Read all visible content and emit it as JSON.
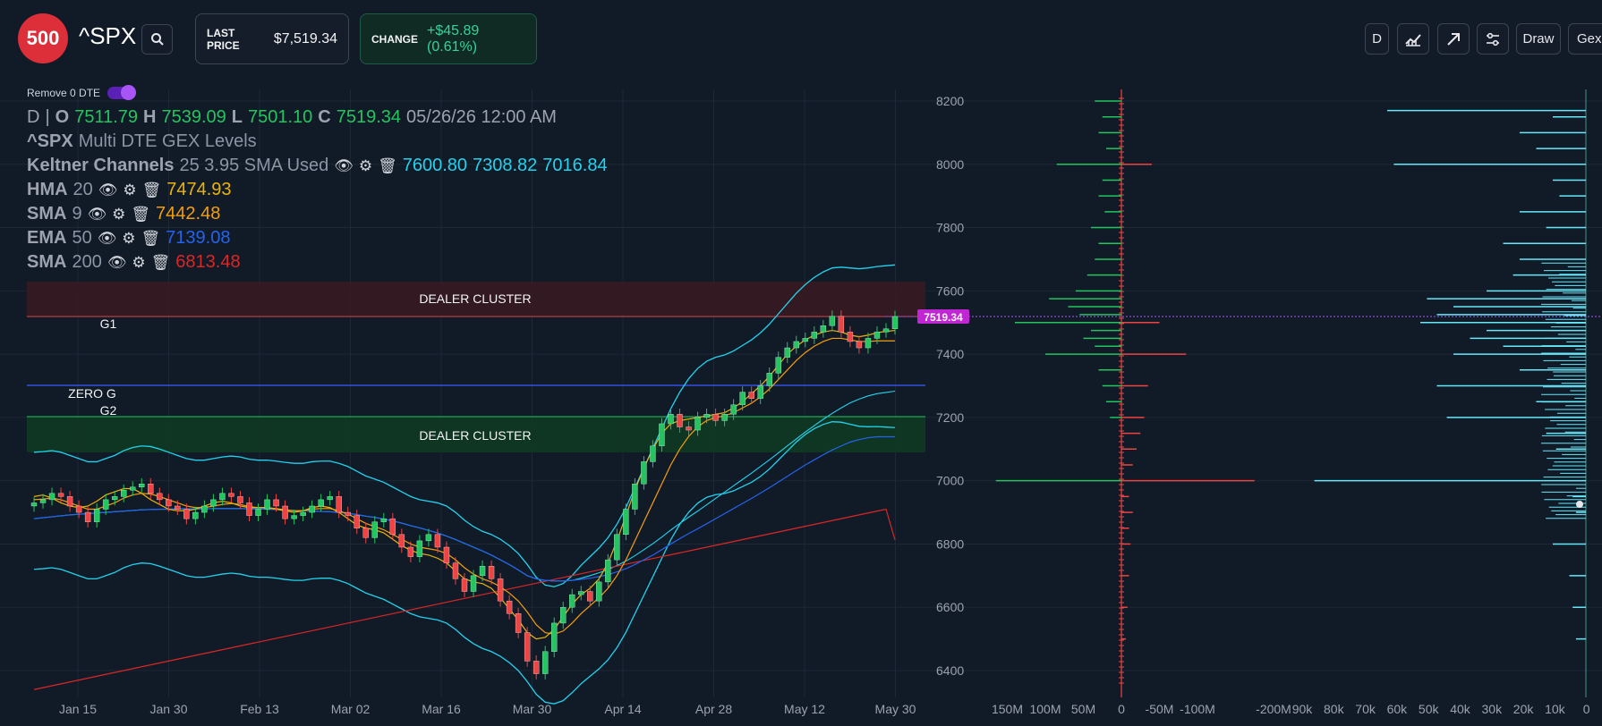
{
  "header": {
    "logo": "500",
    "ticker": "^SPX",
    "last_price_label": "LAST PRICE",
    "last_price": "$7,519.34",
    "change_label": "CHANGE",
    "change": "+$45.89 (0.61%)",
    "buttons": {
      "interval": "D",
      "draw": "Draw",
      "gex": "Gex"
    }
  },
  "toggle": {
    "label": "Remove 0 DTE",
    "on": true
  },
  "ohlc": {
    "interval": "D",
    "o_label": "O",
    "o": "7511.79",
    "h_label": "H",
    "h": "7539.09",
    "l_label": "L",
    "l": "7501.10",
    "c_label": "C",
    "c": "7519.34",
    "datetime": "05/26/26 12:00 AM"
  },
  "indicators": {
    "title_sym": "^SPX",
    "title_rest": "Multi DTE GEX Levels",
    "keltner_name": "Keltner Channels",
    "keltner_params": "25 3.95 SMA Used",
    "keltner_upper": "7600.80",
    "keltner_mid": "7308.82",
    "keltner_lower": "7016.84",
    "hma_name": "HMA",
    "hma_param": "20",
    "hma_val": "7474.93",
    "sma9_name": "SMA",
    "sma9_param": "9",
    "sma9_val": "7442.48",
    "ema_name": "EMA",
    "ema_param": "50",
    "ema_val": "7139.08",
    "sma200_name": "SMA",
    "sma200_param": "200",
    "sma200_val": "6813.48"
  },
  "levels": {
    "dealer_cluster_top": "DEALER CLUSTER",
    "dealer_cluster_bottom": "DEALER CLUSTER",
    "g1": "G1",
    "zero_g": "ZERO G",
    "g2": "G2",
    "price_tag": "7519.34"
  },
  "colors": {
    "up": "#22c55e",
    "down": "#ef4444",
    "keltner": "#22d3ee",
    "hma": "#eab308",
    "sma9": "#f59e0b",
    "ema": "#2563eb",
    "sma200": "#dc2626",
    "zero_g": "#3b5cff",
    "accent": "#c026d3"
  },
  "chart_data": {
    "type": "line",
    "x_ticks": [
      "Jan 15",
      "Jan 30",
      "Feb 13",
      "Mar 02",
      "Mar 16",
      "Mar 30",
      "Apr 14",
      "Apr 28",
      "May 12",
      "May 30"
    ],
    "y_ticks": [
      "8200",
      "8000",
      "7800",
      "7600",
      "7400",
      "7200",
      "7000",
      "6800",
      "6600",
      "6400"
    ],
    "ylim": [
      6320,
      8230
    ],
    "close": [
      6930,
      6940,
      6960,
      6950,
      6920,
      6900,
      6870,
      6910,
      6940,
      6950,
      6970,
      6980,
      6990,
      6960,
      6940,
      6920,
      6910,
      6880,
      6900,
      6920,
      6940,
      6960,
      6950,
      6930,
      6890,
      6910,
      6940,
      6920,
      6880,
      6890,
      6900,
      6920,
      6940,
      6950,
      6900,
      6890,
      6850,
      6820,
      6870,
      6880,
      6830,
      6790,
      6760,
      6810,
      6830,
      6790,
      6740,
      6690,
      6650,
      6700,
      6730,
      6690,
      6620,
      6580,
      6520,
      6430,
      6390,
      6460,
      6550,
      6600,
      6640,
      6650,
      6620,
      6680,
      6750,
      6830,
      6910,
      6990,
      7060,
      7110,
      7180,
      7210,
      7170,
      7160,
      7200,
      7210,
      7190,
      7210,
      7240,
      7280,
      7260,
      7300,
      7340,
      7390,
      7420,
      7440,
      7450,
      7470,
      7490,
      7520,
      7470,
      7440,
      7420,
      7450,
      7470,
      7480,
      7519
    ],
    "hma": [
      6950,
      6955,
      6945,
      6930,
      6920,
      6915,
      6920,
      6935,
      6955,
      6965,
      6975,
      6975,
      6960,
      6940,
      6925,
      6910,
      6905,
      6905,
      6910,
      6920,
      6930,
      6935,
      6930,
      6920,
      6915,
      6915,
      6915,
      6910,
      6905,
      6900,
      6905,
      6915,
      6920,
      6915,
      6900,
      6880,
      6860,
      6850,
      6845,
      6835,
      6815,
      6795,
      6780,
      6770,
      6765,
      6755,
      6740,
      6715,
      6690,
      6680,
      6675,
      6660,
      6630,
      6595,
      6560,
      6520,
      6500,
      6505,
      6530,
      6570,
      6610,
      6640,
      6660,
      6690,
      6740,
      6810,
      6890,
      6970,
      7040,
      7100,
      7150,
      7180,
      7190,
      7195,
      7200,
      7205,
      7210,
      7215,
      7230,
      7250,
      7275,
      7300,
      7330,
      7365,
      7400,
      7425,
      7445,
      7460,
      7470,
      7475,
      7470,
      7460,
      7455,
      7460,
      7468,
      7472,
      7475
    ],
    "sma9": [
      6940,
      6942,
      6945,
      6940,
      6930,
      6920,
      6910,
      6910,
      6920,
      6930,
      6945,
      6955,
      6960,
      6958,
      6950,
      6940,
      6930,
      6920,
      6915,
      6915,
      6920,
      6925,
      6928,
      6925,
      6918,
      6915,
      6915,
      6912,
      6908,
      6905,
      6905,
      6910,
      6912,
      6912,
      6905,
      6895,
      6880,
      6865,
      6855,
      6845,
      6830,
      6815,
      6800,
      6790,
      6785,
      6780,
      6770,
      6750,
      6725,
      6705,
      6690,
      6680,
      6665,
      6645,
      6620,
      6585,
      6545,
      6520,
      6515,
      6525,
      6550,
      6580,
      6605,
      6630,
      6660,
      6700,
      6750,
      6810,
      6870,
      6930,
      6990,
      7050,
      7100,
      7140,
      7170,
      7190,
      7200,
      7205,
      7215,
      7230,
      7245,
      7265,
      7290,
      7320,
      7350,
      7380,
      7405,
      7425,
      7440,
      7450,
      7450,
      7445,
      7440,
      7440,
      7442,
      7442,
      7442
    ],
    "ema50": [
      6880,
      6883,
      6886,
      6889,
      6892,
      6894,
      6896,
      6898,
      6900,
      6902,
      6904,
      6906,
      6908,
      6909,
      6910,
      6910,
      6911,
      6911,
      6911,
      6911,
      6912,
      6912,
      6912,
      6912,
      6911,
      6911,
      6910,
      6909,
      6908,
      6906,
      6905,
      6904,
      6903,
      6902,
      6900,
      6897,
      6893,
      6888,
      6884,
      6879,
      6873,
      6866,
      6858,
      6851,
      6843,
      6835,
      6825,
      6814,
      6802,
      6790,
      6778,
      6765,
      6750,
      6735,
      6718,
      6700,
      6690,
      6685,
      6683,
      6683,
      6685,
      6688,
      6692,
      6697,
      6703,
      6712,
      6722,
      6735,
      6750,
      6765,
      6782,
      6800,
      6817,
      6833,
      6848,
      6864,
      6880,
      6896,
      6912,
      6928,
      6944,
      6961,
      6978,
      6996,
      7014,
      7032,
      7050,
      7066,
      7082,
      7097,
      7110,
      7122,
      7130,
      7136,
      7139,
      7139,
      7139
    ],
    "sma200": [
      6340,
      6346,
      6352,
      6358,
      6364,
      6370,
      6376,
      6382,
      6388,
      6394,
      6400,
      6406,
      6412,
      6418,
      6424,
      6430,
      6436,
      6442,
      6448,
      6454,
      6460,
      6466,
      6472,
      6478,
      6484,
      6490,
      6496,
      6502,
      6508,
      6514,
      6520,
      6526,
      6532,
      6538,
      6544,
      6550,
      6556,
      6562,
      6568,
      6574,
      6580,
      6586,
      6592,
      6598,
      6604,
      6610,
      6616,
      6622,
      6628,
      6634,
      6640,
      6646,
      6652,
      6658,
      6664,
      6670,
      6676,
      6682,
      6688,
      6694,
      6700,
      6706,
      6712,
      6718,
      6724,
      6730,
      6736,
      6742,
      6748,
      6754,
      6760,
      6766,
      6772,
      6778,
      6784,
      6790,
      6796,
      6802,
      6808,
      6814,
      6820,
      6826,
      6832,
      6838,
      6844,
      6850,
      6856,
      6862,
      6868,
      6874,
      6880,
      6886,
      6892,
      6898,
      6904,
      6910,
      6813
    ],
    "gex_x_ticks": [
      "150M",
      "100M",
      "50M",
      "0",
      "-50M",
      "-100M",
      "-200M"
    ],
    "vol_x_ticks": [
      "90k",
      "80k",
      "70k",
      "60k",
      "50k",
      "40k",
      "30k",
      "20k",
      "10k",
      "0"
    ],
    "gex_bars": [
      {
        "strike": 8200,
        "value": 35
      },
      {
        "strike": 8150,
        "value": 25
      },
      {
        "strike": 8100,
        "value": 30
      },
      {
        "strike": 8050,
        "value": 20
      },
      {
        "strike": 8000,
        "value": 85
      },
      {
        "strike": 8000,
        "value": -40
      },
      {
        "strike": 7950,
        "value": 25
      },
      {
        "strike": 7900,
        "value": 30
      },
      {
        "strike": 7850,
        "value": 22
      },
      {
        "strike": 7800,
        "value": 40
      },
      {
        "strike": 7750,
        "value": 30
      },
      {
        "strike": 7700,
        "value": 35
      },
      {
        "strike": 7650,
        "value": 45
      },
      {
        "strike": 7600,
        "value": 60
      },
      {
        "strike": 7575,
        "value": 95
      },
      {
        "strike": 7550,
        "value": 70
      },
      {
        "strike": 7525,
        "value": 55
      },
      {
        "strike": 7500,
        "value": 140
      },
      {
        "strike": 7500,
        "value": -50
      },
      {
        "strike": 7475,
        "value": 40
      },
      {
        "strike": 7450,
        "value": 50
      },
      {
        "strike": 7425,
        "value": 35
      },
      {
        "strike": 7400,
        "value": 100
      },
      {
        "strike": 7400,
        "value": -85
      },
      {
        "strike": 7350,
        "value": 30
      },
      {
        "strike": 7300,
        "value": 25
      },
      {
        "strike": 7300,
        "value": -35
      },
      {
        "strike": 7250,
        "value": 20
      },
      {
        "strike": 7200,
        "value": 15
      },
      {
        "strike": 7200,
        "value": -30
      },
      {
        "strike": 7150,
        "value": -25
      },
      {
        "strike": 7100,
        "value": -20
      },
      {
        "strike": 7050,
        "value": -15
      },
      {
        "strike": 7000,
        "value": 165
      },
      {
        "strike": 7000,
        "value": -175
      },
      {
        "strike": 6950,
        "value": -10
      },
      {
        "strike": 6900,
        "value": -15
      },
      {
        "strike": 6850,
        "value": -10
      },
      {
        "strike": 6800,
        "value": -12
      },
      {
        "strike": 6700,
        "value": -10
      },
      {
        "strike": 6600,
        "value": -8
      },
      {
        "strike": 6500,
        "value": -6
      }
    ],
    "volume_bars": [
      {
        "strike": 8170,
        "value": 60
      },
      {
        "strike": 8150,
        "value": 10
      },
      {
        "strike": 8100,
        "value": 20
      },
      {
        "strike": 8050,
        "value": 15
      },
      {
        "strike": 8000,
        "value": 58
      },
      {
        "strike": 7950,
        "value": 10
      },
      {
        "strike": 7900,
        "value": 8
      },
      {
        "strike": 7850,
        "value": 20
      },
      {
        "strike": 7800,
        "value": 12
      },
      {
        "strike": 7750,
        "value": 25
      },
      {
        "strike": 7700,
        "value": 20
      },
      {
        "strike": 7650,
        "value": 22
      },
      {
        "strike": 7600,
        "value": 30
      },
      {
        "strike": 7575,
        "value": 48
      },
      {
        "strike": 7550,
        "value": 40
      },
      {
        "strike": 7525,
        "value": 45
      },
      {
        "strike": 7500,
        "value": 50
      },
      {
        "strike": 7475,
        "value": 30
      },
      {
        "strike": 7450,
        "value": 35
      },
      {
        "strike": 7425,
        "value": 25
      },
      {
        "strike": 7400,
        "value": 40
      },
      {
        "strike": 7350,
        "value": 20
      },
      {
        "strike": 7300,
        "value": 45
      },
      {
        "strike": 7250,
        "value": 15
      },
      {
        "strike": 7200,
        "value": 42
      },
      {
        "strike": 7150,
        "value": 12
      },
      {
        "strike": 7100,
        "value": 9
      },
      {
        "strike": 7000,
        "value": 82
      },
      {
        "strike": 6950,
        "value": 4
      },
      {
        "strike": 6900,
        "value": 3
      },
      {
        "strike": 6800,
        "value": 10
      },
      {
        "strike": 6700,
        "value": 5
      },
      {
        "strike": 6600,
        "value": 4
      },
      {
        "strike": 6500,
        "value": 3
      }
    ]
  }
}
